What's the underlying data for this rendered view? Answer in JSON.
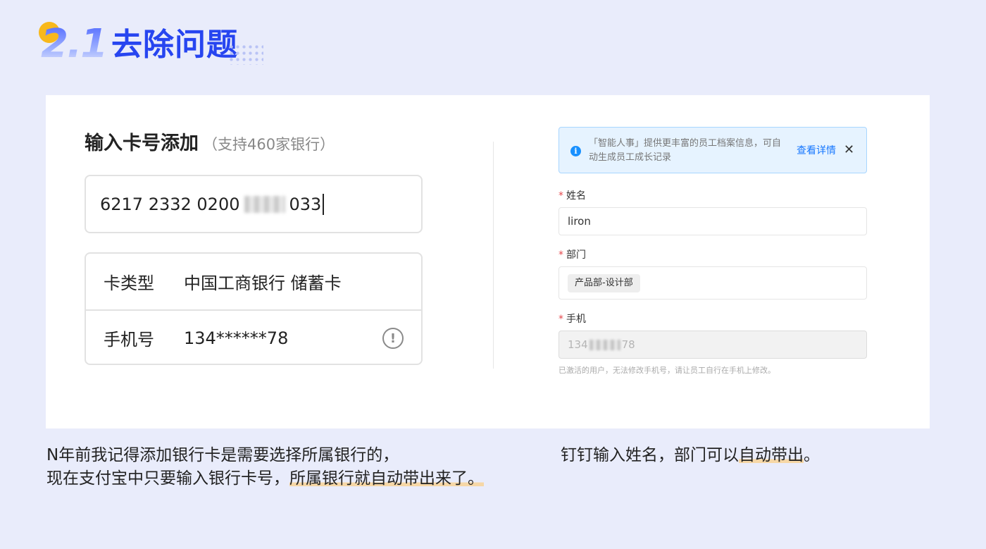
{
  "header": {
    "section_number": "2.1",
    "section_title": "去除问题"
  },
  "left_form": {
    "title": "输入卡号添加",
    "subtitle": "（支持460家银行）",
    "card_number_prefix": "6217 2332 0200",
    "card_number_suffix": "033",
    "card_type_label": "卡类型",
    "card_type_value": "中国工商银行 储蓄卡",
    "phone_label": "手机号",
    "phone_value": "134******78",
    "warn_icon_glyph": "!"
  },
  "right_form": {
    "alert": {
      "icon_glyph": "i",
      "text": "「智能人事」提供更丰富的员工档案信息，可自动生成员工成长记录",
      "link": "查看详情",
      "close_glyph": "✕"
    },
    "name_label": "姓名",
    "name_value": "liron",
    "dept_label": "部门",
    "dept_tag": "产品部-设计部",
    "phone_label": "手机",
    "phone_prefix": "134",
    "phone_suffix": "78",
    "required_mark": "*",
    "hint": "已激活的用户，无法修改手机号，请让员工自行在手机上修改。"
  },
  "captions": {
    "left_line1": "N年前我记得添加银行卡是需要选择所属银行的，",
    "left_line2_plain": "现在支付宝中只要输入银行卡号，",
    "left_line2_highlight": "所属银行就自动带出来了。",
    "right_plain": "钉钉输入姓名，部门可以",
    "right_highlight": "自动带出",
    "right_end": "。"
  },
  "colors": {
    "accent": "#2745f0",
    "background": "#e9ecfb",
    "highlight": "#f6d7a6",
    "link": "#1677ff"
  }
}
